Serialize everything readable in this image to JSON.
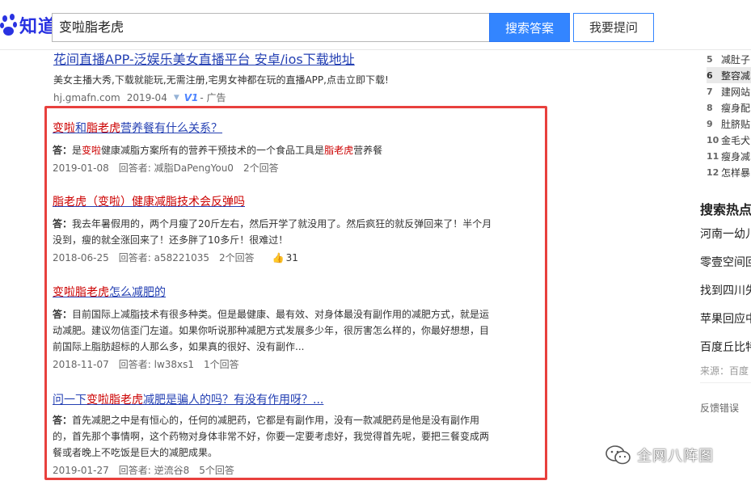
{
  "header": {
    "logo_text": "知道",
    "search_value": "变啦脂老虎",
    "search_button": "搜索答案",
    "ask_button": "我要提问"
  },
  "ad": {
    "title": "花间直播APP-泛娱乐美女直播平台 安卓/ios下载地址",
    "desc": "美女主播大秀,下载就能玩,无需注册,宅男女神都在玩的直播APP,点击立即下载!",
    "domain": "hj.gmafn.com",
    "date": "2019-04",
    "v_badge": "V1",
    "ad_label": "- 广告"
  },
  "results": [
    {
      "title_parts": [
        "变啦",
        "和",
        "脂老虎",
        "营养餐有什么关系？"
      ],
      "answer_label": "答：",
      "answer_parts": [
        "是",
        "变啦",
        "健康减脂方案所有的营养干预技术的一个食品工具是",
        "脂老虎",
        "营养餐"
      ],
      "date": "2019-01-08",
      "answerer": "回答者: 减脂DaPengYou0",
      "count": "2个回答"
    },
    {
      "title_parts": [
        "脂老虎（变啦）健康减脂技术会反弹吗"
      ],
      "answer_label": "答：",
      "answer_line1": "我去年暑假用的，两个月瘦了20斤左右，然后开学了就没用了。然后疯狂的就反弹回来了！半个月",
      "answer_line2": "没到，瘦的就全涨回来了！还多胖了10多斤！很难过！",
      "date": "2018-06-25",
      "answerer": "回答者: a58221035",
      "count": "2个回答",
      "likes": "31"
    },
    {
      "title_parts": [
        "变啦脂老虎",
        "怎么减肥的"
      ],
      "answer_label": "答：",
      "answer_line1": "目前国际上减脂技术有很多种类。但是最健康、最有效、对身体最没有副作用的减肥方式，就是运",
      "answer_line2": "动减肥。建议勿信歪门左道。如果你听说那种减肥方式发展多少年，很厉害怎么样的，你最好想想，目",
      "answer_line3": "前国际上脂肪超标的人那么多，如果真的很好、没有副作...",
      "date": "2018-11-07",
      "answerer": "回答者: lw38xs1",
      "count": "1个回答"
    },
    {
      "title_parts": [
        "问一下",
        "变啦脂老虎",
        "减肥是骗人的吗？有没有作用呀？..."
      ],
      "answer_label": "答：",
      "answer_line1": "首先减肥之中是有恒心的，任何的减肥药，它都是有副作用，没有一款减肥药是他是没有副作用",
      "answer_line2": "的，首先那个事情啊，这个药物对身体非常不好，你要一定要考虑好，我觉得首先呢，要把三餐变成两",
      "answer_line3": "餐或者晚上不吃饭是巨大的减肥成果。",
      "date": "2019-01-27",
      "answerer": "回答者: 逆流谷8",
      "count": "5个回答"
    }
  ],
  "sidebar": {
    "rank": [
      {
        "num": "5",
        "text": "减肚子"
      },
      {
        "num": "6",
        "text": "整容减"
      },
      {
        "num": "7",
        "text": "建网站"
      },
      {
        "num": "8",
        "text": "瘦身配"
      },
      {
        "num": "9",
        "text": "肚脐贴"
      },
      {
        "num": "10",
        "text": "金毛犬"
      },
      {
        "num": "11",
        "text": "瘦身减"
      },
      {
        "num": "12",
        "text": "怎样暴"
      }
    ],
    "hot_title": "搜索热点",
    "hot_items": [
      "河南一幼儿",
      "零壹空间回",
      "找到四川失",
      "苹果回应中",
      "百度丘比特"
    ],
    "source": "来源：百度",
    "feedback": "反馈错误"
  },
  "watermark": {
    "text": "全网八阵图"
  },
  "colors": {
    "link": "#2440b3",
    "highlight": "#cc0000",
    "accent": "#3385ff",
    "redbox": "#e8403d"
  }
}
